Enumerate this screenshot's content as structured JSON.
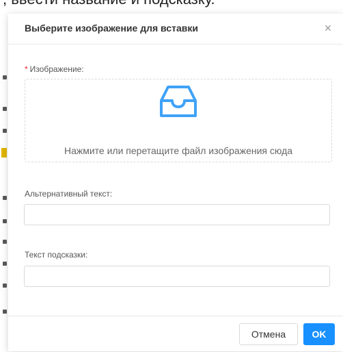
{
  "background": {
    "top_text": ", ввести название и подсказку."
  },
  "dialog": {
    "title": "Выберите изображение для вставки",
    "close_symbol": "×",
    "image_field": {
      "required_mark": "*",
      "label": "Изображение:",
      "upload_icon": "inbox-icon",
      "hint": "Нажмите или перетащите файл изображения сюда"
    },
    "alt_field": {
      "label": "Альтернативный текст:",
      "value": "",
      "placeholder": ""
    },
    "tooltip_field": {
      "label": "Текст подсказки:",
      "value": "",
      "placeholder": ""
    },
    "footer": {
      "cancel_label": "Отмена",
      "ok_label": "OK"
    }
  },
  "colors": {
    "primary": "#1890ff",
    "required": "#f5222d",
    "icon": "#3fa2f7"
  }
}
